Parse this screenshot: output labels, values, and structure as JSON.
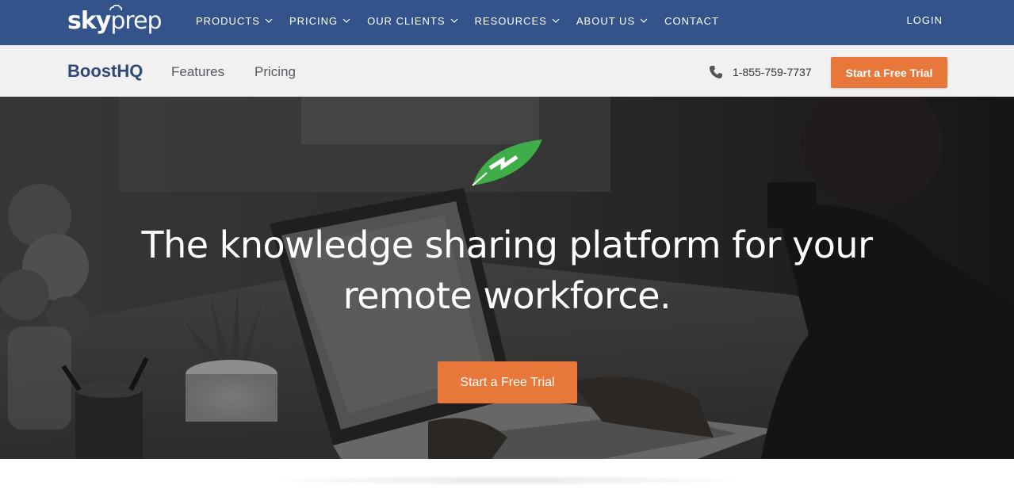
{
  "topnav": {
    "logo": {
      "part1": "sky",
      "part2": "prep"
    },
    "menu": [
      {
        "label": "PRODUCTS",
        "has_dropdown": true
      },
      {
        "label": "PRICING",
        "has_dropdown": true
      },
      {
        "label": "OUR CLIENTS",
        "has_dropdown": true
      },
      {
        "label": "RESOURCES",
        "has_dropdown": true
      },
      {
        "label": "ABOUT US",
        "has_dropdown": true
      },
      {
        "label": "CONTACT",
        "has_dropdown": false
      }
    ],
    "login_label": "LOGIN",
    "background_color": "#33538a"
  },
  "subnav": {
    "brand": "BoostHQ",
    "links": [
      "Features",
      "Pricing"
    ],
    "phone_icon": "phone-icon",
    "phone": "1-855-759-7737",
    "cta_label": "Start a Free Trial"
  },
  "hero": {
    "leaf_icon": "green-leaf-bolt-icon",
    "title_line1": "The knowledge sharing platform for your",
    "title_line2": "remote workforce.",
    "cta_label": "Start a Free Trial"
  },
  "colors": {
    "accent": "#e8783a",
    "brand_blue": "#2f4a78",
    "leaf_green": "#3fae49"
  }
}
